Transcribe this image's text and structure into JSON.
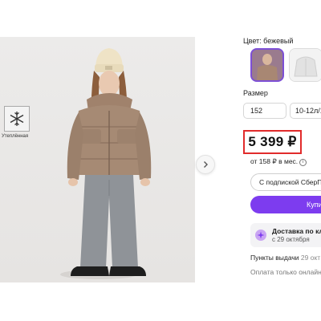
{
  "image": {
    "feature_badge_label": "Утеплённая"
  },
  "color": {
    "label": "Цвет: бежевый"
  },
  "size": {
    "label": "Размер",
    "value": "152",
    "option": "10-12л/1"
  },
  "price": {
    "amount": "5 399 ₽",
    "installment": "от 158 ₽ в мес."
  },
  "actions": {
    "subscription": "С подпиской СберПрп",
    "buy": "Купи"
  },
  "delivery": {
    "title": "Доставка по кл",
    "date": "с 29 октября"
  },
  "pickup": {
    "label": "Пункты выдачи",
    "date": "29 окт"
  },
  "payment": {
    "online": "Оплата только онлайн"
  },
  "colors": {
    "accent": "#7d3cef",
    "highlight": "#e12b2b"
  }
}
